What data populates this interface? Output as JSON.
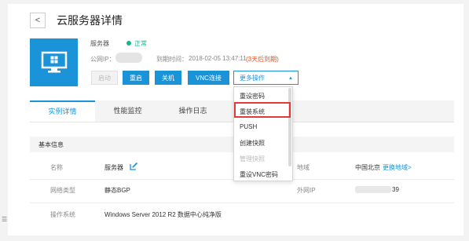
{
  "header": {
    "back_icon": "chevron-left-icon",
    "title": "云服务器详情"
  },
  "server": {
    "icon": "windows-monitor-icon",
    "type_label": "服务器",
    "status": "正常",
    "status_color": "#1ab394",
    "ip_label": "公网IP：",
    "expire_label": "到期时间：",
    "expire_value": "2018-02-05 13:47:11",
    "expire_warning": "(3天后到期)",
    "warning_color": "#e8501a"
  },
  "actions": {
    "start": "启动",
    "restart": "重启",
    "shutdown": "关机",
    "vnc": "VNC连接",
    "more": "更多操作"
  },
  "more_menu": {
    "items": [
      "重设密码",
      "重装系统",
      "PUSH",
      "创建快照",
      "管理快照",
      "重设VNC密码"
    ],
    "highlighted": "重装系统"
  },
  "tabs": [
    "实例详情",
    "性能监控",
    "操作日志"
  ],
  "active_tab": "实例详情",
  "accent_color": "#1a93d8",
  "basic_info": {
    "section_title": "基本信息",
    "rows": [
      {
        "label": "名称",
        "value": "服务器"
      },
      {
        "label": "网络类型",
        "value": "静态BGP"
      },
      {
        "label": "操作系统",
        "value": "Windows Server 2012 R2 数据中心纯净版"
      }
    ],
    "region_label": "地域",
    "region_value": "中国北京",
    "change_region_link": "更换地域>",
    "public_ip_label": "外网IP",
    "public_ip_suffix": "39"
  }
}
